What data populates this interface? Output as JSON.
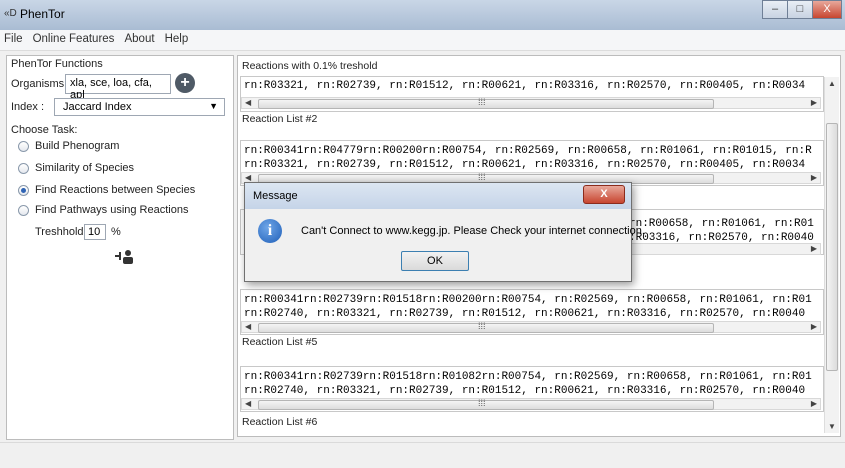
{
  "window": {
    "title": "PhenTor",
    "app_icon": "«D",
    "min": "–",
    "max": "□",
    "close": "X"
  },
  "menu": [
    "File",
    "Online Features",
    "About",
    "Help"
  ],
  "left": {
    "group_title": "PhenTor Functions",
    "organisms_label": "Organisms :",
    "organisms_value": "xla, sce, loa, cfa, apl",
    "add_symbol": "+",
    "index_label": "Index :",
    "index_value": "Jaccard Index",
    "choose_task": "Choose Task:",
    "tasks": [
      {
        "label": "Build Phenogram",
        "selected": false
      },
      {
        "label": "Similarity of Species",
        "selected": false
      },
      {
        "label": "Find Reactions between Species",
        "selected": true
      },
      {
        "label": "Find Pathways using Reactions",
        "selected": false
      }
    ],
    "threshold_label": "Treshhold:",
    "threshold_value": "10",
    "percent": "%"
  },
  "right": {
    "header": "Reactions with 0.1% treshold",
    "lists": [
      {
        "label": "",
        "lines": [
          "rn:R03321, rn:R02739, rn:R01512, rn:R00621, rn:R03316, rn:R02570, rn:R00405, rn:R0034"
        ]
      },
      {
        "label": "Reaction List #2",
        "lines": [
          "rn:R00341rn:R04779rn:R00200rn:R00754, rn:R02569, rn:R00658, rn:R01061, rn:R01015, rn:R",
          "rn:R03321, rn:R02739, rn:R01512, rn:R00621, rn:R03316, rn:R02570, rn:R00405, rn:R0034"
        ]
      },
      {
        "label": "",
        "lines": [
          "rn:R00658, rn:R01061, rn:R01",
          ":R03316, rn:R02570, rn:R0040"
        ]
      },
      {
        "label": "",
        "lines": [
          "rn:R00341rn:R02739rn:R01518rn:R00200rn:R00754, rn:R02569, rn:R00658, rn:R01061, rn:R01",
          "rn:R02740, rn:R03321, rn:R02739, rn:R01512, rn:R00621, rn:R03316, rn:R02570, rn:R0040"
        ]
      },
      {
        "label": "Reaction List #5",
        "lines": [
          "rn:R00341rn:R02739rn:R01518rn:R01082rn:R00754, rn:R02569, rn:R00658, rn:R01061, rn:R01",
          "rn:R02740, rn:R03321, rn:R02739, rn:R01512, rn:R00621, rn:R03316, rn:R02570, rn:R0040"
        ]
      }
    ],
    "last_label": "Reaction List #6"
  },
  "dialog": {
    "title": "Message",
    "close": "X",
    "info_icon": "i",
    "message": "Can't Connect to www.kegg.jp. Please Check your internet connection.",
    "ok": "OK"
  }
}
